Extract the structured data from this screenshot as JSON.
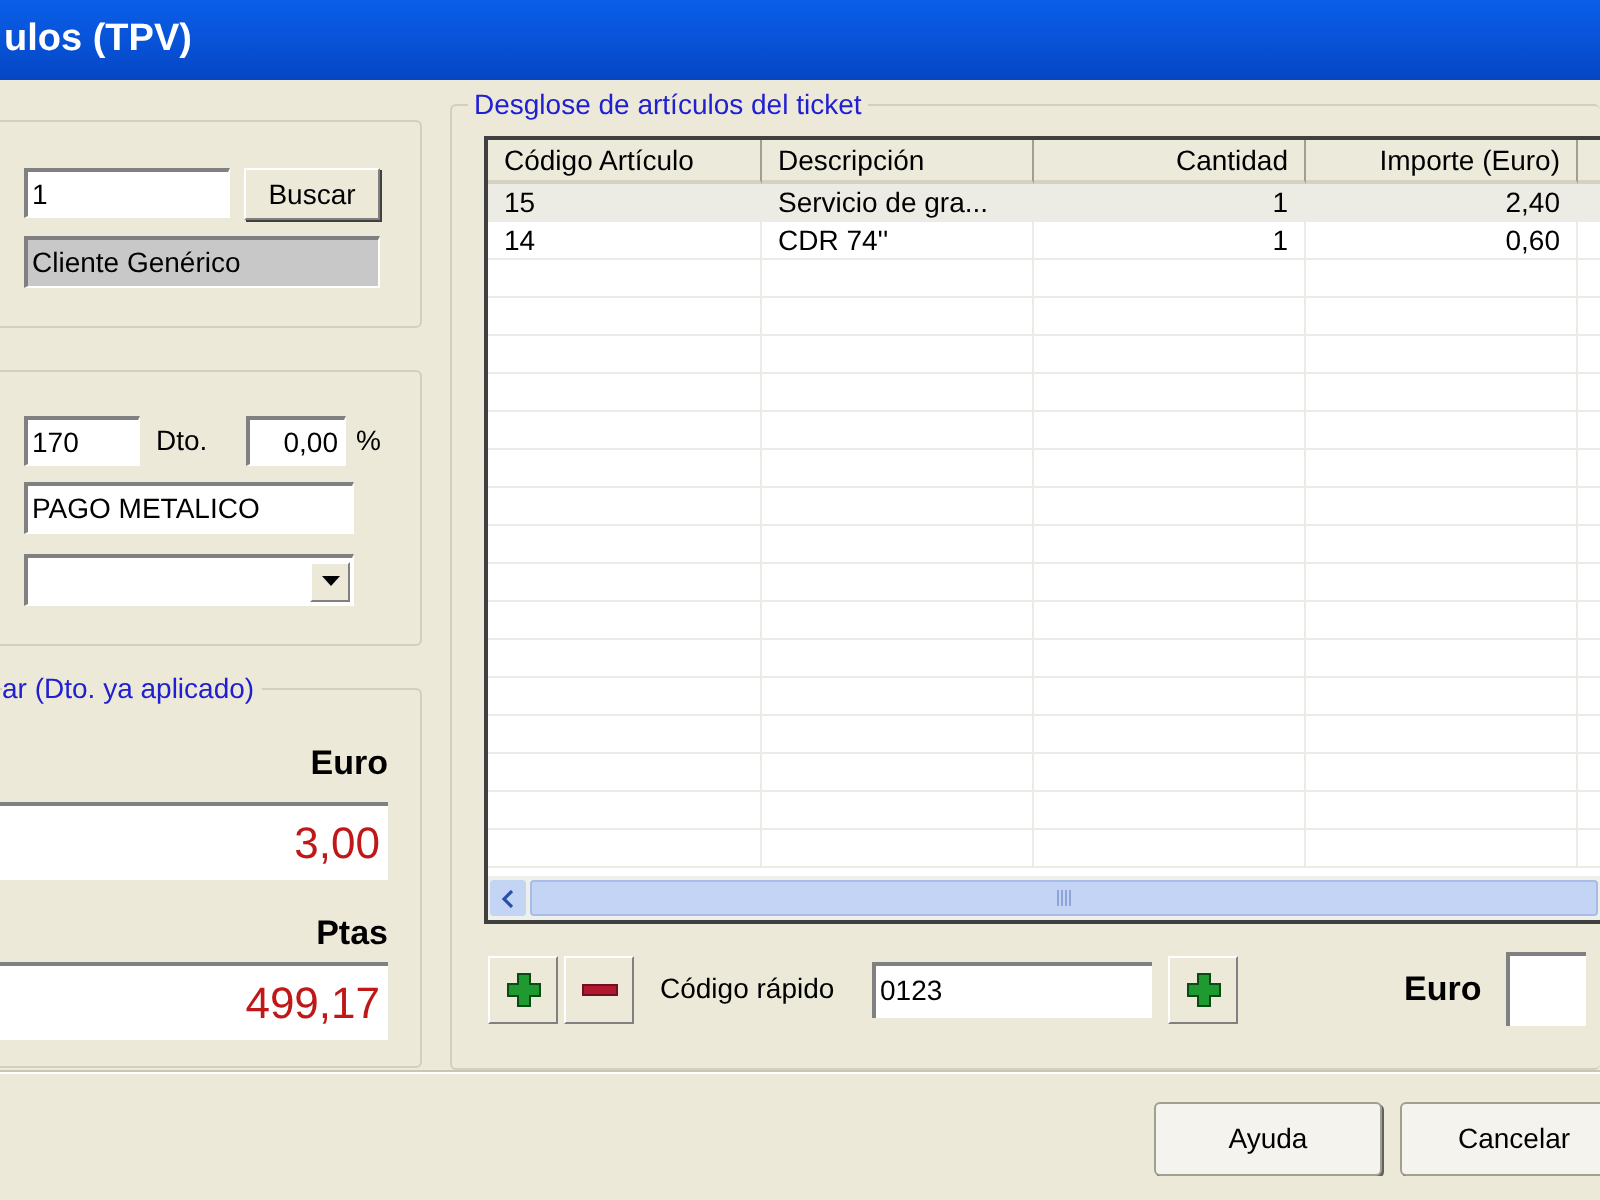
{
  "window": {
    "title": "ulos (TPV)"
  },
  "client": {
    "code": "1",
    "search_button": "Buscar",
    "name": "Cliente Genérico"
  },
  "payment": {
    "code": "170",
    "discount_label": "Dto.",
    "discount": "0,00",
    "percent": "%",
    "method": "PAGO METALICO"
  },
  "totals": {
    "legend": "ar (Dto. ya aplicado)",
    "euro_label": "Euro",
    "euro": "3,00",
    "ptas_label": "Ptas",
    "ptas": "499,17"
  },
  "ticket": {
    "legend": "Desglose de artículos del ticket",
    "columns": [
      {
        "label": "Código Artículo",
        "numeric": false
      },
      {
        "label": "Descripción",
        "numeric": false
      },
      {
        "label": "Cantidad",
        "numeric": true
      },
      {
        "label": "Importe (Euro)",
        "numeric": true
      }
    ],
    "rows": [
      {
        "cells": [
          "15",
          "Servicio de gra...",
          "1",
          "2,40"
        ],
        "selected": true
      },
      {
        "cells": [
          "14",
          "CDR 74''",
          "1",
          "0,60"
        ],
        "selected": false
      }
    ]
  },
  "quick": {
    "label": "Código rápido",
    "value": "0123",
    "euro_label": "Euro"
  },
  "buttons": [
    "Ayuda",
    "Cancelar"
  ]
}
